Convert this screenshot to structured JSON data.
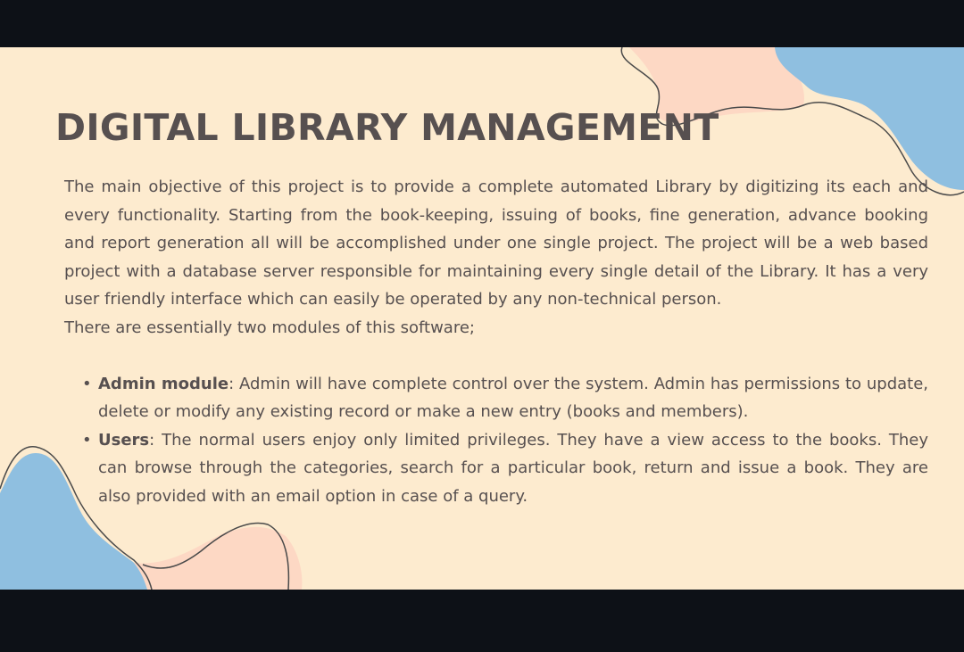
{
  "slide": {
    "title": "DIGITAL LIBRARY MANAGEMENT",
    "intro": "The main objective of this project is to provide a complete automated Library by digitizing its each and every functionality. Starting from the book-keeping, issuing of books, fine generation, advance booking and report generation all will be accomplished under one single project. The project will be a web based project with a database server responsible for maintaining every single detail of the Library. It has a very user friendly interface which can easily be operated by any non-technical person.",
    "modules_intro": "There are essentially two modules of this software;",
    "bullet": "•",
    "modules": [
      {
        "term": "Admin module",
        "description": ": Admin will have complete control over the system. Admin has permissions to update, delete or modify any existing record or make a new entry (books and members)."
      },
      {
        "term": "Users",
        "description": ": The normal users enjoy only limited privileges. They have a view access to the books. They can browse through the categories, search for a particular book, return and issue a book. They are also provided with an email option in case of a query."
      }
    ]
  },
  "colors": {
    "letterbox": "#0d1117",
    "background": "#fdebcf",
    "text": "#575050",
    "blob_blue": "#8fbfe0",
    "blob_peach": "#fdd8c4",
    "outline": "#4a4a4a"
  }
}
